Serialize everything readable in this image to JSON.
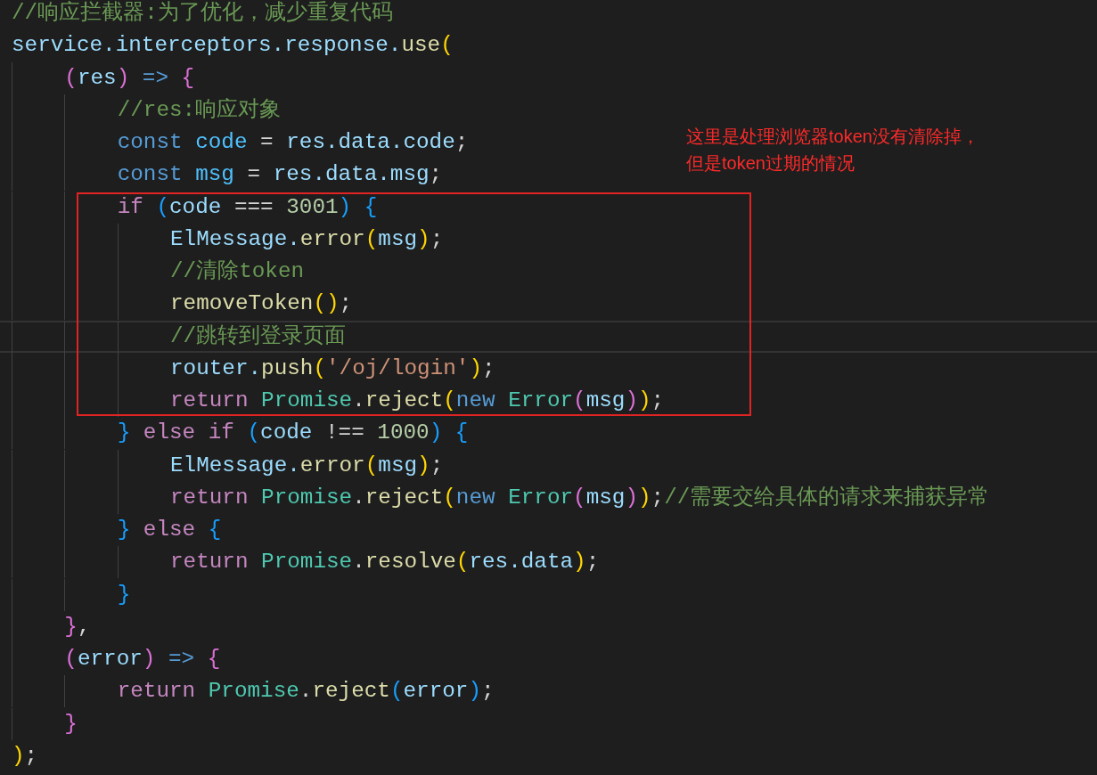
{
  "editor": {
    "blocks": [
      {
        "kind": "plain",
        "lines": [
          {
            "current": false,
            "tokens": [
              {
                "text": "//响应拦截器:为了优化，减少重复代码",
                "kind": "comment"
              }
            ]
          },
          {
            "current": false,
            "tokens": [
              {
                "text": "service.interceptors.response.",
                "kind": "var"
              },
              {
                "text": "use",
                "kind": "fn"
              },
              {
                "text": "(",
                "kind": "b1"
              }
            ]
          },
          {
            "current": false,
            "tokens": [
              {
                "text": "    (",
                "kind": "b2"
              },
              {
                "text": "res",
                "kind": "var"
              },
              {
                "text": ") ",
                "kind": "b2"
              },
              {
                "text": "=> ",
                "kind": "keyword"
              },
              {
                "text": "{",
                "kind": "b2"
              }
            ]
          },
          {
            "current": false,
            "tokens": [
              {
                "text": "        //res:响应对象",
                "kind": "comment"
              }
            ]
          },
          {
            "current": false,
            "tokens": [
              {
                "text": "        const ",
                "kind": "keyword"
              },
              {
                "text": "code",
                "kind": "const"
              },
              {
                "text": " = ",
                "kind": "plain"
              },
              {
                "text": "res.data.code",
                "kind": "var"
              },
              {
                "text": ";",
                "kind": "plain"
              }
            ]
          },
          {
            "current": false,
            "tokens": [
              {
                "text": "        const ",
                "kind": "keyword"
              },
              {
                "text": "msg",
                "kind": "const"
              },
              {
                "text": " = ",
                "kind": "plain"
              },
              {
                "text": "res.data.msg",
                "kind": "var"
              },
              {
                "text": ";",
                "kind": "plain"
              }
            ]
          }
        ]
      },
      {
        "kind": "framed",
        "lines": [
          {
            "current": false,
            "tokens": [
              {
                "text": "        if ",
                "kind": "control"
              },
              {
                "text": "(",
                "kind": "b3"
              },
              {
                "text": "code",
                "kind": "var"
              },
              {
                "text": " === ",
                "kind": "plain"
              },
              {
                "text": "3001",
                "kind": "number"
              },
              {
                "text": ") {",
                "kind": "b3"
              }
            ]
          },
          {
            "current": false,
            "tokens": [
              {
                "text": "            ElMessage.",
                "kind": "var"
              },
              {
                "text": "error",
                "kind": "fn"
              },
              {
                "text": "(",
                "kind": "b1"
              },
              {
                "text": "msg",
                "kind": "var"
              },
              {
                "text": ")",
                "kind": "b1"
              },
              {
                "text": ";",
                "kind": "plain"
              }
            ]
          },
          {
            "current": false,
            "tokens": [
              {
                "text": "            //清除token",
                "kind": "comment"
              }
            ]
          },
          {
            "current": false,
            "tokens": [
              {
                "text": "            removeToken",
                "kind": "fn"
              },
              {
                "text": "()",
                "kind": "b1"
              },
              {
                "text": ";",
                "kind": "plain"
              }
            ]
          },
          {
            "current": true,
            "tokens": [
              {
                "text": "            //跳转到登录页面",
                "kind": "comment"
              }
            ]
          },
          {
            "current": false,
            "tokens": [
              {
                "text": "            router.",
                "kind": "var"
              },
              {
                "text": "push",
                "kind": "fn"
              },
              {
                "text": "(",
                "kind": "b1"
              },
              {
                "text": "'/oj/login'",
                "kind": "string"
              },
              {
                "text": ")",
                "kind": "b1"
              },
              {
                "text": ";",
                "kind": "plain"
              }
            ]
          },
          {
            "current": false,
            "tokens": [
              {
                "text": "            return ",
                "kind": "control"
              },
              {
                "text": "Promise",
                "kind": "type"
              },
              {
                "text": ".",
                "kind": "plain"
              },
              {
                "text": "reject",
                "kind": "fn"
              },
              {
                "text": "(",
                "kind": "b1"
              },
              {
                "text": "new ",
                "kind": "keyword"
              },
              {
                "text": "Error",
                "kind": "type"
              },
              {
                "text": "(",
                "kind": "b2"
              },
              {
                "text": "msg",
                "kind": "var"
              },
              {
                "text": ")",
                "kind": "b2"
              },
              {
                "text": ")",
                "kind": "b1"
              },
              {
                "text": ";",
                "kind": "plain"
              }
            ]
          }
        ]
      },
      {
        "kind": "plain",
        "lines": [
          {
            "current": false,
            "tokens": [
              {
                "text": "        } ",
                "kind": "b3"
              },
              {
                "text": "else if ",
                "kind": "control"
              },
              {
                "text": "(",
                "kind": "b3"
              },
              {
                "text": "code",
                "kind": "var"
              },
              {
                "text": " !== ",
                "kind": "plain"
              },
              {
                "text": "1000",
                "kind": "number"
              },
              {
                "text": ") {",
                "kind": "b3"
              }
            ]
          },
          {
            "current": false,
            "tokens": [
              {
                "text": "            ElMessage.",
                "kind": "var"
              },
              {
                "text": "error",
                "kind": "fn"
              },
              {
                "text": "(",
                "kind": "b1"
              },
              {
                "text": "msg",
                "kind": "var"
              },
              {
                "text": ")",
                "kind": "b1"
              },
              {
                "text": ";",
                "kind": "plain"
              }
            ]
          },
          {
            "current": false,
            "tokens": [
              {
                "text": "            return ",
                "kind": "control"
              },
              {
                "text": "Promise",
                "kind": "type"
              },
              {
                "text": ".",
                "kind": "plain"
              },
              {
                "text": "reject",
                "kind": "fn"
              },
              {
                "text": "(",
                "kind": "b1"
              },
              {
                "text": "new ",
                "kind": "keyword"
              },
              {
                "text": "Error",
                "kind": "type"
              },
              {
                "text": "(",
                "kind": "b2"
              },
              {
                "text": "msg",
                "kind": "var"
              },
              {
                "text": ")",
                "kind": "b2"
              },
              {
                "text": ")",
                "kind": "b1"
              },
              {
                "text": ";",
                "kind": "plain"
              },
              {
                "text": "//需要交给具体的请求来捕获异常",
                "kind": "comment"
              }
            ]
          },
          {
            "current": false,
            "tokens": [
              {
                "text": "        } ",
                "kind": "b3"
              },
              {
                "text": "else ",
                "kind": "control"
              },
              {
                "text": "{",
                "kind": "b3"
              }
            ]
          },
          {
            "current": false,
            "tokens": [
              {
                "text": "            return ",
                "kind": "control"
              },
              {
                "text": "Promise",
                "kind": "type"
              },
              {
                "text": ".",
                "kind": "plain"
              },
              {
                "text": "resolve",
                "kind": "fn"
              },
              {
                "text": "(",
                "kind": "b1"
              },
              {
                "text": "res.data",
                "kind": "var"
              },
              {
                "text": ")",
                "kind": "b1"
              },
              {
                "text": ";",
                "kind": "plain"
              }
            ]
          },
          {
            "current": false,
            "tokens": [
              {
                "text": "        }",
                "kind": "b3"
              }
            ]
          },
          {
            "current": false,
            "tokens": [
              {
                "text": "    }",
                "kind": "b2"
              },
              {
                "text": ",",
                "kind": "plain"
              }
            ]
          },
          {
            "current": false,
            "tokens": [
              {
                "text": "    (",
                "kind": "b2"
              },
              {
                "text": "error",
                "kind": "var"
              },
              {
                "text": ") ",
                "kind": "b2"
              },
              {
                "text": "=> ",
                "kind": "keyword"
              },
              {
                "text": "{",
                "kind": "b2"
              }
            ]
          },
          {
            "current": false,
            "tokens": [
              {
                "text": "        return ",
                "kind": "control"
              },
              {
                "text": "Promise",
                "kind": "type"
              },
              {
                "text": ".",
                "kind": "plain"
              },
              {
                "text": "reject",
                "kind": "fn"
              },
              {
                "text": "(",
                "kind": "b3"
              },
              {
                "text": "error",
                "kind": "var"
              },
              {
                "text": ")",
                "kind": "b3"
              },
              {
                "text": ";",
                "kind": "plain"
              }
            ]
          },
          {
            "current": false,
            "tokens": [
              {
                "text": "    }",
                "kind": "b2"
              }
            ]
          },
          {
            "current": false,
            "tokens": [
              {
                "text": ")",
                "kind": "b1"
              },
              {
                "text": ";",
                "kind": "plain"
              }
            ]
          }
        ]
      }
    ]
  },
  "annotation": {
    "lines": [
      "这里是处理浏览器token没有清除掉，",
      "但是token过期的情况"
    ]
  }
}
